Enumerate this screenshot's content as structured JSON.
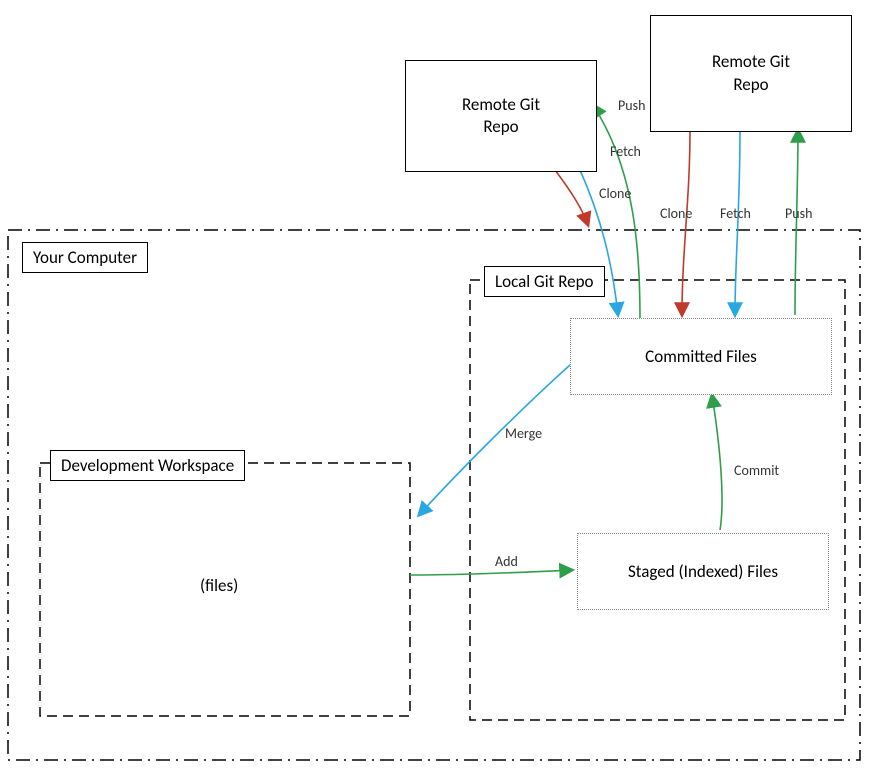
{
  "boxes": {
    "computer_label": "Your Computer",
    "dev_ws_label": "Development Workspace",
    "local_repo_label": "Local Git Repo",
    "committed": "Committed Files",
    "staged": "Staged (Indexed) Files",
    "files": "(files)",
    "remote1": "Remote Git\nRepo",
    "remote2": "Remote Git\nRepo"
  },
  "edges": {
    "push1": "Push",
    "fetch1": "Fetch",
    "clone1": "Clone",
    "clone2": "Clone",
    "fetch2": "Fetch",
    "push2": "Push",
    "merge": "Merge",
    "commit": "Commit",
    "add": "Add"
  },
  "colors": {
    "push": "#2e9e4a",
    "fetch": "#2aa6e0",
    "clone": "#c0392b",
    "merge": "#2aa6e0",
    "commit": "#2e9e4a",
    "add": "#2e9e4a"
  }
}
